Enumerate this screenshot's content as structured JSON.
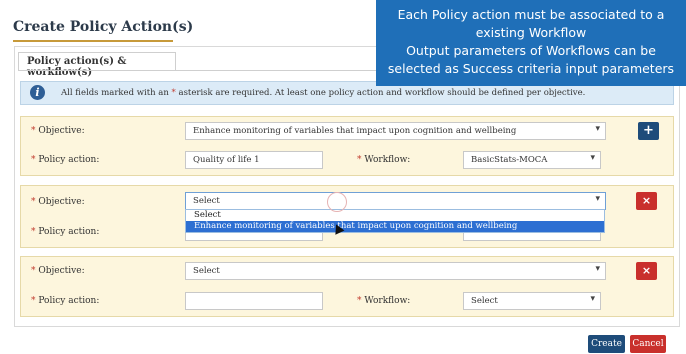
{
  "page": {
    "title": "Create Policy Action(s)",
    "section_legend": "Policy action(s) & workflow(s)"
  },
  "info": {
    "icon": "info-icon",
    "text_before": "All fields marked with an ",
    "star": "*",
    "text_after": " asterisk are required. At least one policy action and workflow should be defined per objective."
  },
  "labels": {
    "objective": "* Objective:",
    "policy_action": "* Policy action:",
    "workflow": "* Workflow:"
  },
  "rows": [
    {
      "objective": "Enhance monitoring of variables that impact upon cognition and wellbeing",
      "policy_action": "Quality of life 1",
      "workflow": "BasicStats-MOCA",
      "action_button": "+"
    },
    {
      "objective": "Select",
      "policy_action": "",
      "workflow": "",
      "action_button": "×"
    },
    {
      "objective": "Select",
      "policy_action": "",
      "workflow": "Select",
      "action_button": "×"
    }
  ],
  "dropdown": {
    "options": [
      "Select",
      "Enhance monitoring of variables that impact upon cognition and wellbeing"
    ],
    "highlighted_index": 1
  },
  "footer": {
    "create": "Create",
    "cancel": "Cancel"
  },
  "overlay_note": {
    "lines": [
      "Each Policy action must be associated to a",
      "existing Workflow",
      "Output parameters of Workflows can be",
      "selected as Success criteria input parameters"
    ]
  },
  "colors": {
    "primary": "#1e4c7a",
    "danger": "#c9302c",
    "row_bg": "#fdf6dd",
    "info_bg": "#dcebf7",
    "overlay_bg": "#1f6fb8"
  }
}
